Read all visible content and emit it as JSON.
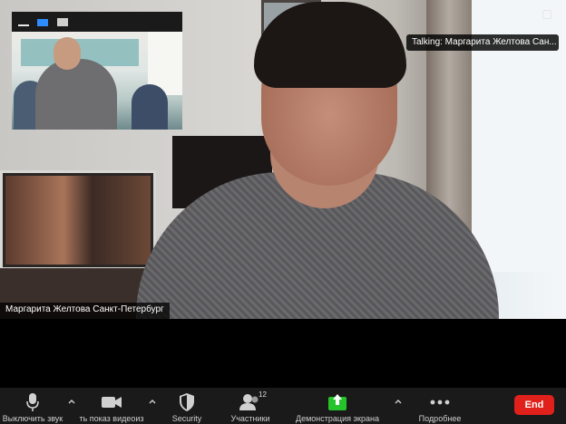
{
  "main_video": {
    "speaker_name": "Маргарита Желтова Санкт-Петербург"
  },
  "talking_indicator": {
    "text": "Talking: Маргарита Желтова Сан..."
  },
  "toolbar": {
    "mute_label": "Выключить звук",
    "video_label": "ть показ видеоиз",
    "security_label": "Security",
    "participants_label": "Участники",
    "participants_count": "12",
    "share_label": "Демонстрация экрана",
    "more_label": "Подробнее",
    "end_label": "End"
  },
  "icons": [
    "microphone-icon",
    "video-camera-icon",
    "shield-icon",
    "participants-icon",
    "share-screen-icon",
    "more-dots-icon",
    "caret-up-icon"
  ],
  "colors": {
    "end_button": "#e0201b",
    "share_icon": "#25c42a",
    "toolbar_bg": "#1a1a1a",
    "thumb_accent": "#2d8cff"
  }
}
